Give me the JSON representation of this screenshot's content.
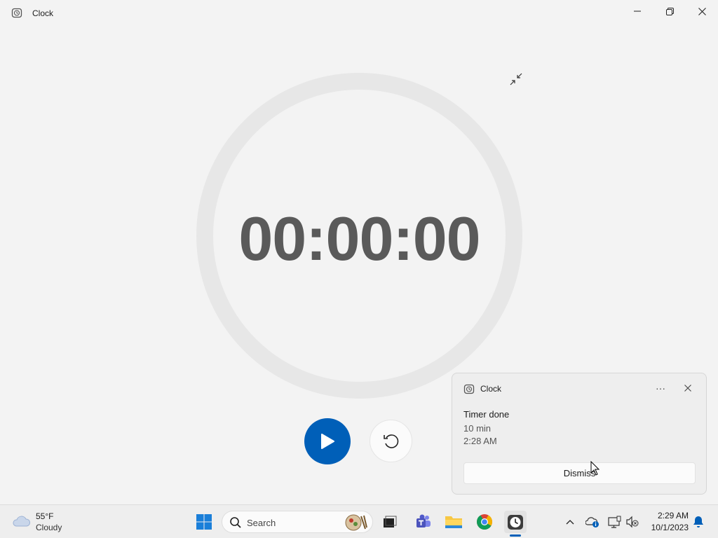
{
  "window": {
    "title": "Clock",
    "icon": "clock-app-icon"
  },
  "timer": {
    "display": "00:00:00",
    "progress": 0
  },
  "controls": {
    "play_icon": "play-icon",
    "reset_icon": "reset-icon"
  },
  "toast": {
    "app_name": "Clock",
    "more": "···",
    "title": "Timer done",
    "line1": "10 min",
    "line2": "2:28 AM",
    "dismiss_label": "Dismiss"
  },
  "taskbar": {
    "weather": {
      "temp": "55°F",
      "desc": "Cloudy",
      "icon": "cloud-icon"
    },
    "search_placeholder": "Search",
    "apps": [
      "start",
      "search",
      "task-view",
      "teams",
      "file-explorer",
      "chrome",
      "clock"
    ],
    "clock": {
      "time": "2:29 AM",
      "date": "10/1/2023"
    }
  },
  "colors": {
    "accent": "#005fb8",
    "background": "#f3f3f3",
    "ring": "#e7e7e7",
    "timer_text": "#5a5a5a"
  }
}
